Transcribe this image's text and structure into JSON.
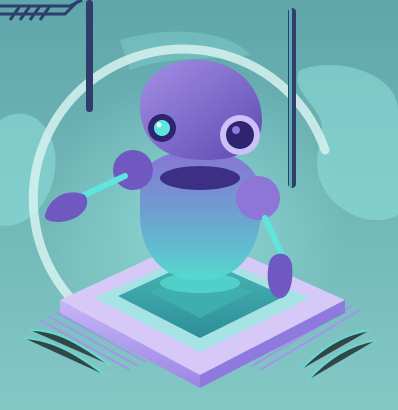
{
  "colors": {
    "bg_top": "#6cb0b1",
    "bg_bottom": "#7dc2c2",
    "teal_glow": "#8fe3e0",
    "aqua": "#5ee6dd",
    "ring": "#cfeeed",
    "bar_dark": "#2f3d6b",
    "robot_purple": "#7b63c9",
    "robot_violet": "#9a86e0",
    "robot_shadow": "#51409a",
    "chip_top": "#3aa6a8",
    "chip_base": "#b9a7f0",
    "pins": "#a98ff0"
  },
  "icons": [
    "circuit-corner-icon"
  ]
}
